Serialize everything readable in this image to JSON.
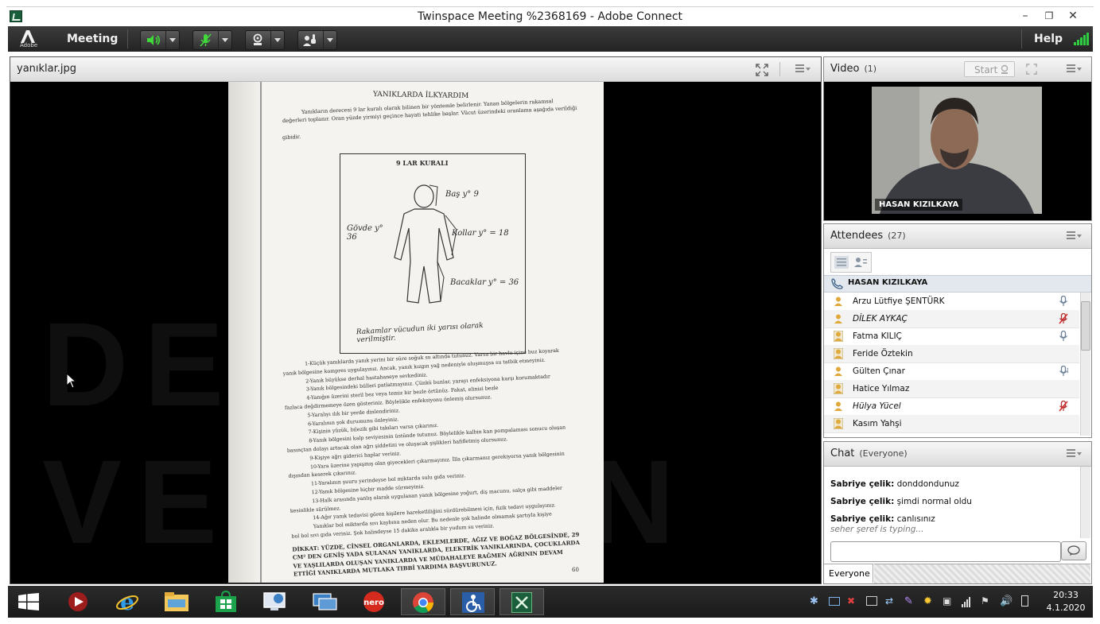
{
  "window": {
    "title": "Twinspace Meeting %2368169 - Adobe Connect",
    "controls": [
      "minimize",
      "restore",
      "close"
    ]
  },
  "menubar": {
    "logo_text": "Adobe",
    "meeting_label": "Meeting",
    "help_label": "Help",
    "tools": [
      {
        "name": "speaker-icon",
        "active": true
      },
      {
        "name": "microphone-muted-icon",
        "active": true
      },
      {
        "name": "webcam-icon",
        "active": false
      },
      {
        "name": "raise-hand-icon",
        "active": false
      }
    ],
    "signal_color": "#2ecc40"
  },
  "share_pod": {
    "title": "yanıklar.jpg",
    "watermark": "DEMO VERSION",
    "document": {
      "heading": "YANIKLARDA İLKYARDIM",
      "intro_1": "Yanıkların derecesi 9 lar kuralı olarak bilinen bir yöntemle belirlenir. Yanan bölgelerin rakamsal",
      "intro_2": "değerleri toplanır. Oran yüzde yirmiyi geçince hayati tehlike başlar. Vücut üzerindeki oranlama aşağıda verildiği",
      "intro_3": "gibidir.",
      "figure_title": "9 LAR KURALI",
      "fig_head": "Baş y° 9",
      "fig_arms": "Kollar y° = 18",
      "fig_body": "Gövde y° 36",
      "fig_legs": "Bacaklar y° = 36",
      "fig_note": "Rakamlar vücudun iki yarısı olarak verilmiştir.",
      "list": [
        "1-Küçük yanıklarda yanık yerini bir süre soğuk su altında tutunuz. Varsa bir havlu içine buz koyarak",
        "yanık bölgesine kompres uygulayınız. Ancak, yanık kızgın yağ nedeniyle oluşmuşsa su tatbik etmeyiniz.",
        "2-Yanık büyükse derhal hastahaneye sevkediniz.",
        "3-Yanık bölgesindeki bülleri patlatmayınız. Çünkü bunlar, yarayı enfeksiyona karşı korumaktadır",
        "4-Yanığın üzerini steril bez veya temiz bir bezle örtünüz. Fakat, elinizi bezle",
        "fazlaca değdirmemeye özen gösteriniz. Böylelikle enfeksiyonu önlemiş olursunuz.",
        "5-Yaralıyı ılık bir yerde dinlendiriniz.",
        "6-Yaralının şok durumunu önleyiniz.",
        "7-Kişinin yüzük, bilezik gibi takıları varsa çıkarınız.",
        "8-Yanık bölgesini kalp seviyesinin üstünde tutunuz. Böylelikle kalbin kan pompalaması sonucu oluşan",
        "basınçtan dolayı artacak olan ağrı şiddetini ve oluşacak şişlikleri hafifletmiş olursunuz.",
        "9-Kişiye ağrı giderici haplar veriniz.",
        "10-Yara üzerine yapışmış olan giyecekleri çıkarmayınız. İlla çıkarmanız gerekiyorsa yanık bölgesinin",
        "dışından keserek çıkarınız.",
        "11-Yaralının şuuru yerindeyse bol miktarda sulu gıda veriniz.",
        "12-Yanık bölgesine hiçbir madde sürmeyiniz.",
        "13-Halk arasında yanlış olarak uygulanan yanık bölgesine yoğurt, diş macunu, salça gibi maddeler",
        "kesinlikle sürülmez.",
        "14-Ağır yanık tedavisi gören kişilere hareketliliğini sürdürebilmesi için, fizik tedavi uygulayınız.",
        "Yanıklar bol miktarda sıvı kaybına neden olur. Bu nedenle şok halinde olmamak şartıyla kişiye",
        "bol bol sıvı gıda veriniz. Şok halindeyse 15 dakika aralıkla bir yudum su veriniz."
      ],
      "warning_1": "DİKKAT: YÜZDE, CİNSEL ORGANLARDA, EKLEMLERDE, AĞIZ VE BOĞAZ BÖLGESİNDE, 29",
      "warning_2": "CM² DEN GENİŞ YADA SULANAN YANIKLARDA, ELEKTRİK YANIKLARINDA, ÇOCUKLARDA",
      "warning_3": "VE YAŞLILARDA OLUŞAN YANIKLARDA VE MÜDAHALEYE RAĞMEN AĞRININ DEVAM",
      "warning_4": "ETTİĞİ YANIKLARDA MUTLAKA TIBBİ YARDIMA BAŞVURUNUZ.",
      "page_num": "60"
    }
  },
  "video_pod": {
    "title": "Video",
    "count": "(1)",
    "start_label": "Start",
    "person_name": "HASAN KIZILKAYA"
  },
  "attendees_pod": {
    "title": "Attendees",
    "count": "(27)",
    "host": "HASAN KIZILKAYA",
    "attendees": [
      {
        "name": "Arzu Lütfiye ŞENTÜRK",
        "mic": "on",
        "role": "participant"
      },
      {
        "name": "DİLEK AYKAÇ",
        "mic": "muted",
        "role": "participant"
      },
      {
        "name": "Fatma KILIÇ",
        "mic": "on",
        "role": "presenter"
      },
      {
        "name": "Feride Öztekin",
        "mic": "none",
        "role": "presenter"
      },
      {
        "name": "Gülten Çınar",
        "mic": "talking",
        "role": "participant"
      },
      {
        "name": "Hatice Yılmaz",
        "mic": "none",
        "role": "presenter"
      },
      {
        "name": "Hülya Yücel",
        "mic": "muted",
        "role": "participant"
      },
      {
        "name": "Kasım Yahşi",
        "mic": "none",
        "role": "presenter"
      }
    ]
  },
  "chat_pod": {
    "title": "Chat",
    "scope": "(Everyone)",
    "messages": [
      {
        "sender": "Sabriye çelik:",
        "text": "donddondunuz"
      },
      {
        "sender": "Sabriye çelik:",
        "text": "şimdi normal oldu"
      },
      {
        "sender": "Sabriye çelik:",
        "text": "canlısınız"
      }
    ],
    "typing": "seher şeref is typing...",
    "input_value": "",
    "tab_label": "Everyone"
  },
  "taskbar": {
    "apps": [
      "start-icon",
      "media-player-icon",
      "internet-explorer-icon",
      "file-explorer-icon",
      "store-icon",
      "remote-desktop-icon",
      "connection-icon",
      "nero-icon",
      "chrome-icon",
      "accessibility-icon",
      "adobe-connect-icon"
    ],
    "time": "20:33",
    "date": "4.1.2020"
  }
}
